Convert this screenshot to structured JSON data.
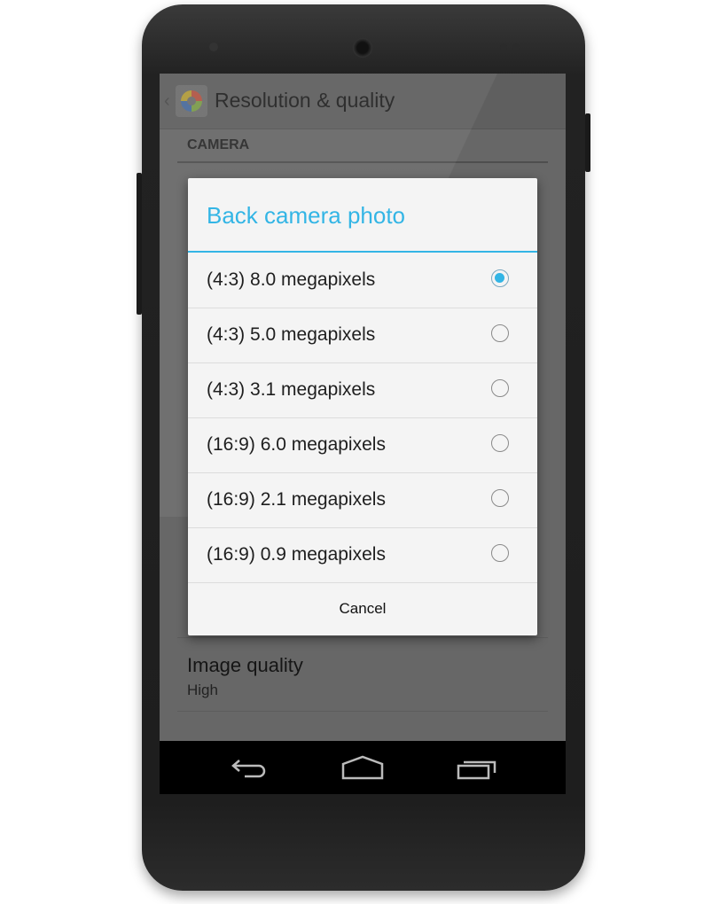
{
  "action_bar": {
    "title": "Resolution & quality",
    "app_icon": "camera-app-icon"
  },
  "settings": {
    "section_header": "CAMERA",
    "image_quality": {
      "title": "Image quality",
      "summary": "High"
    }
  },
  "dialog": {
    "title": "Back camera photo",
    "accent_color": "#33b5e5",
    "options": [
      {
        "label": "(4:3) 8.0 megapixels",
        "selected": true
      },
      {
        "label": "(4:3) 5.0 megapixels",
        "selected": false
      },
      {
        "label": "(4:3) 3.1 megapixels",
        "selected": false
      },
      {
        "label": "(16:9) 6.0 megapixels",
        "selected": false
      },
      {
        "label": "(16:9) 2.1 megapixels",
        "selected": false
      },
      {
        "label": "(16:9) 0.9 megapixels",
        "selected": false
      }
    ],
    "cancel_label": "Cancel"
  },
  "navbar": {
    "icons": [
      "back-icon",
      "home-icon",
      "recents-icon"
    ]
  }
}
